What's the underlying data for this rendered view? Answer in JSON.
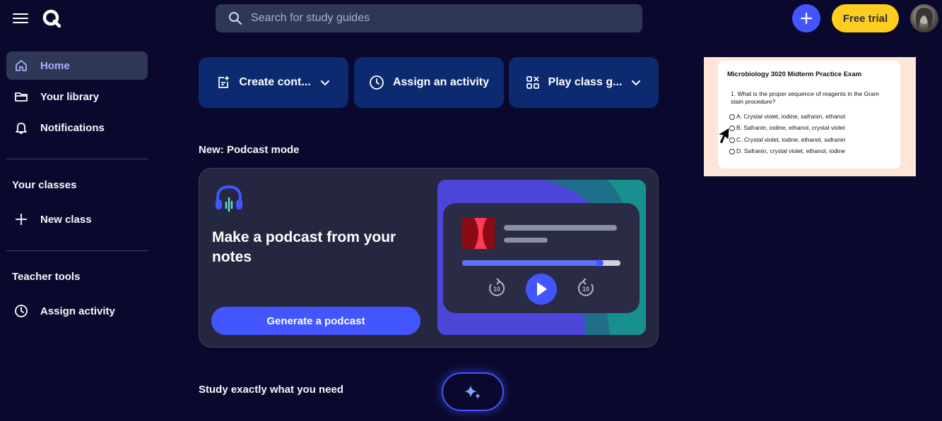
{
  "search": {
    "placeholder": "Search for study guides"
  },
  "header": {
    "trial_label": "Free trial"
  },
  "sidebar": {
    "items": [
      {
        "label": "Home"
      },
      {
        "label": "Your library"
      },
      {
        "label": "Notifications"
      }
    ],
    "classes_heading": "Your classes",
    "new_class_label": "New class",
    "teacher_heading": "Teacher tools",
    "assign_label": "Assign activity"
  },
  "actions": [
    {
      "label": "Create cont..."
    },
    {
      "label": "Assign an activity"
    },
    {
      "label": "Play class g..."
    }
  ],
  "podcast": {
    "section_label": "New: Podcast mode",
    "title": "Make a podcast from your notes",
    "button_label": "Generate a podcast",
    "progress": 0.87
  },
  "preview": {
    "title": "Microbiology 3020 Midterm Practice Exam",
    "question": "1. What is the proper sequence of reagents in the Gram stain procedure?",
    "options": [
      "A. Crystal violet, iodine, safranin, ethanol",
      "B. Safranin, iodine, ethanol, crystal violet",
      "C. Crystal violet, iodine, ethanol, safranin",
      "D. Safranin, crystal violet, ethanol, iodine"
    ]
  },
  "study": {
    "label": "Study exactly what you need"
  },
  "colors": {
    "background": "#0a092d",
    "accent": "#4255ff",
    "trial": "#ffcd1f",
    "action_bg": "#0b2a6f"
  }
}
